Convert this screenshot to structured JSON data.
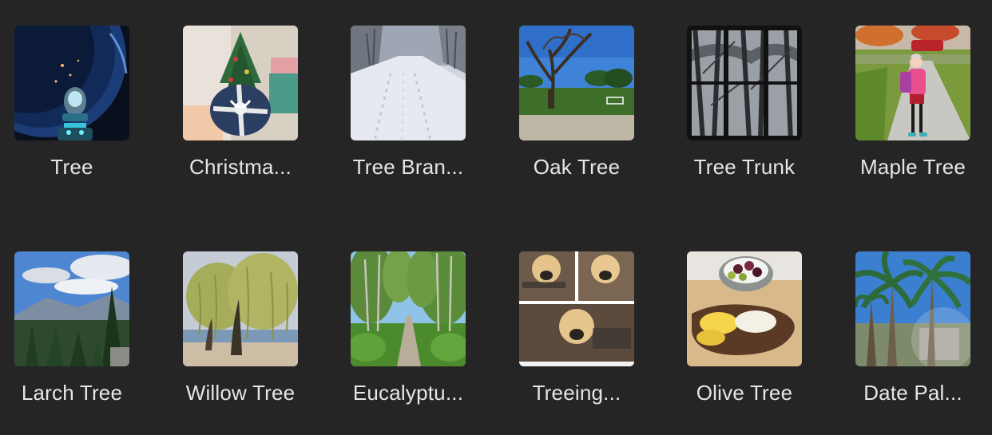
{
  "gallery": {
    "items": [
      {
        "label": "Tree",
        "thumbnail": "earth-space-robot-image"
      },
      {
        "label": "Christma...",
        "thumbnail": "christmas-tree-gift-image"
      },
      {
        "label": "Tree Bran...",
        "thumbnail": "snowy-path-image"
      },
      {
        "label": "Oak Tree",
        "thumbnail": "oak-tree-field-image"
      },
      {
        "label": "Tree Trunk",
        "thumbnail": "window-trees-image"
      },
      {
        "label": "Maple Tree",
        "thumbnail": "girl-sidewalk-autumn-image"
      },
      {
        "label": "Larch Tree",
        "thumbnail": "mountain-conifers-image"
      },
      {
        "label": "Willow Tree",
        "thumbnail": "willow-beach-image"
      },
      {
        "label": "Eucalyptu...",
        "thumbnail": "eucalyptus-path-image"
      },
      {
        "label": "Treeing...",
        "thumbnail": "dog-meme-image"
      },
      {
        "label": "Olive Tree",
        "thumbnail": "olives-bread-eggs-image"
      },
      {
        "label": "Date Pal...",
        "thumbnail": "palm-trees-image"
      }
    ]
  }
}
